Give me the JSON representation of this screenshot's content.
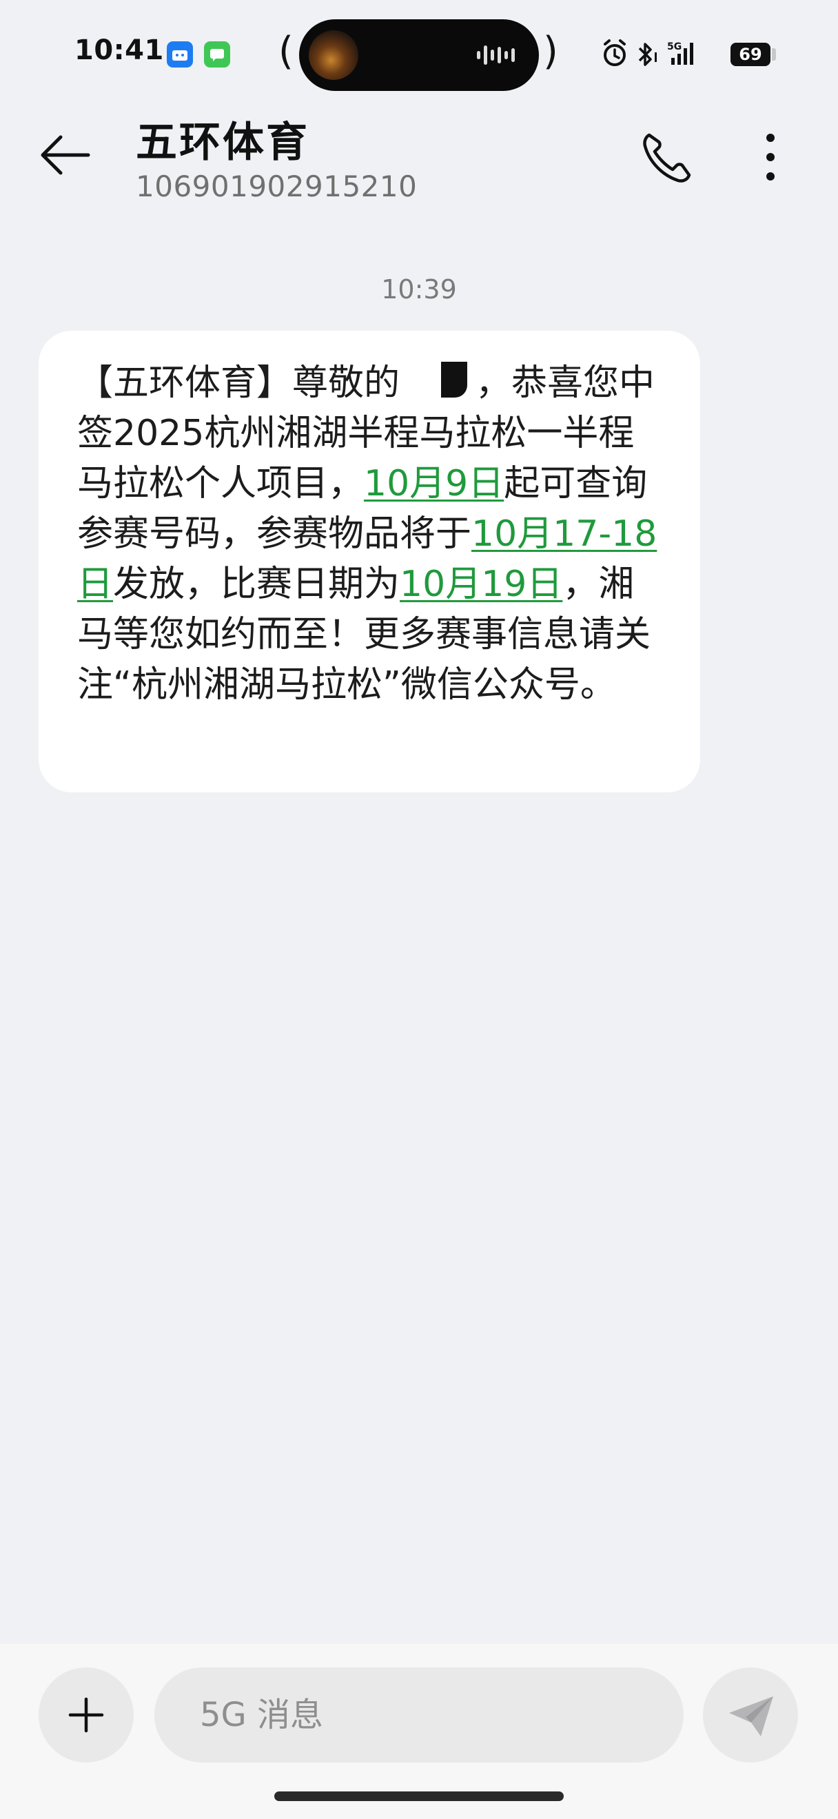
{
  "status_bar": {
    "time": "10:41",
    "battery_level": "69",
    "network": "5G",
    "icons": [
      "notification-blue-app-icon",
      "notification-messages-icon",
      "alarm-icon",
      "bluetooth-icon",
      "signal-icon",
      "battery-icon"
    ]
  },
  "header": {
    "contact_name": "五环体育",
    "contact_number": "106901902915210",
    "icons": [
      "back-arrow-icon",
      "phone-icon",
      "more-vertical-icon"
    ]
  },
  "conversation": {
    "timestamp": "10:39",
    "message": {
      "part1": "【五环体育】尊敬的",
      "part2": "，恭喜您中签2025杭州湘湖半程马拉松一半程马拉松个人项目，",
      "link1": "10月9日",
      "part3": "起可查询参赛号码，参赛物品将于",
      "link2": "10月17-18日",
      "part4": "发放，比赛日期为",
      "link3": "10月19日",
      "part5": "，湘马等您如约而至！更多赛事信息请关注“杭州湘湖马拉松”微信公众号。"
    }
  },
  "composer": {
    "placeholder": "5G 消息",
    "icons": [
      "plus-icon",
      "send-icon"
    ]
  },
  "colors": {
    "background": "#eff1f4",
    "bubble": "#ffffff",
    "link": "#1f9a3c",
    "secondary_text": "#707070"
  }
}
